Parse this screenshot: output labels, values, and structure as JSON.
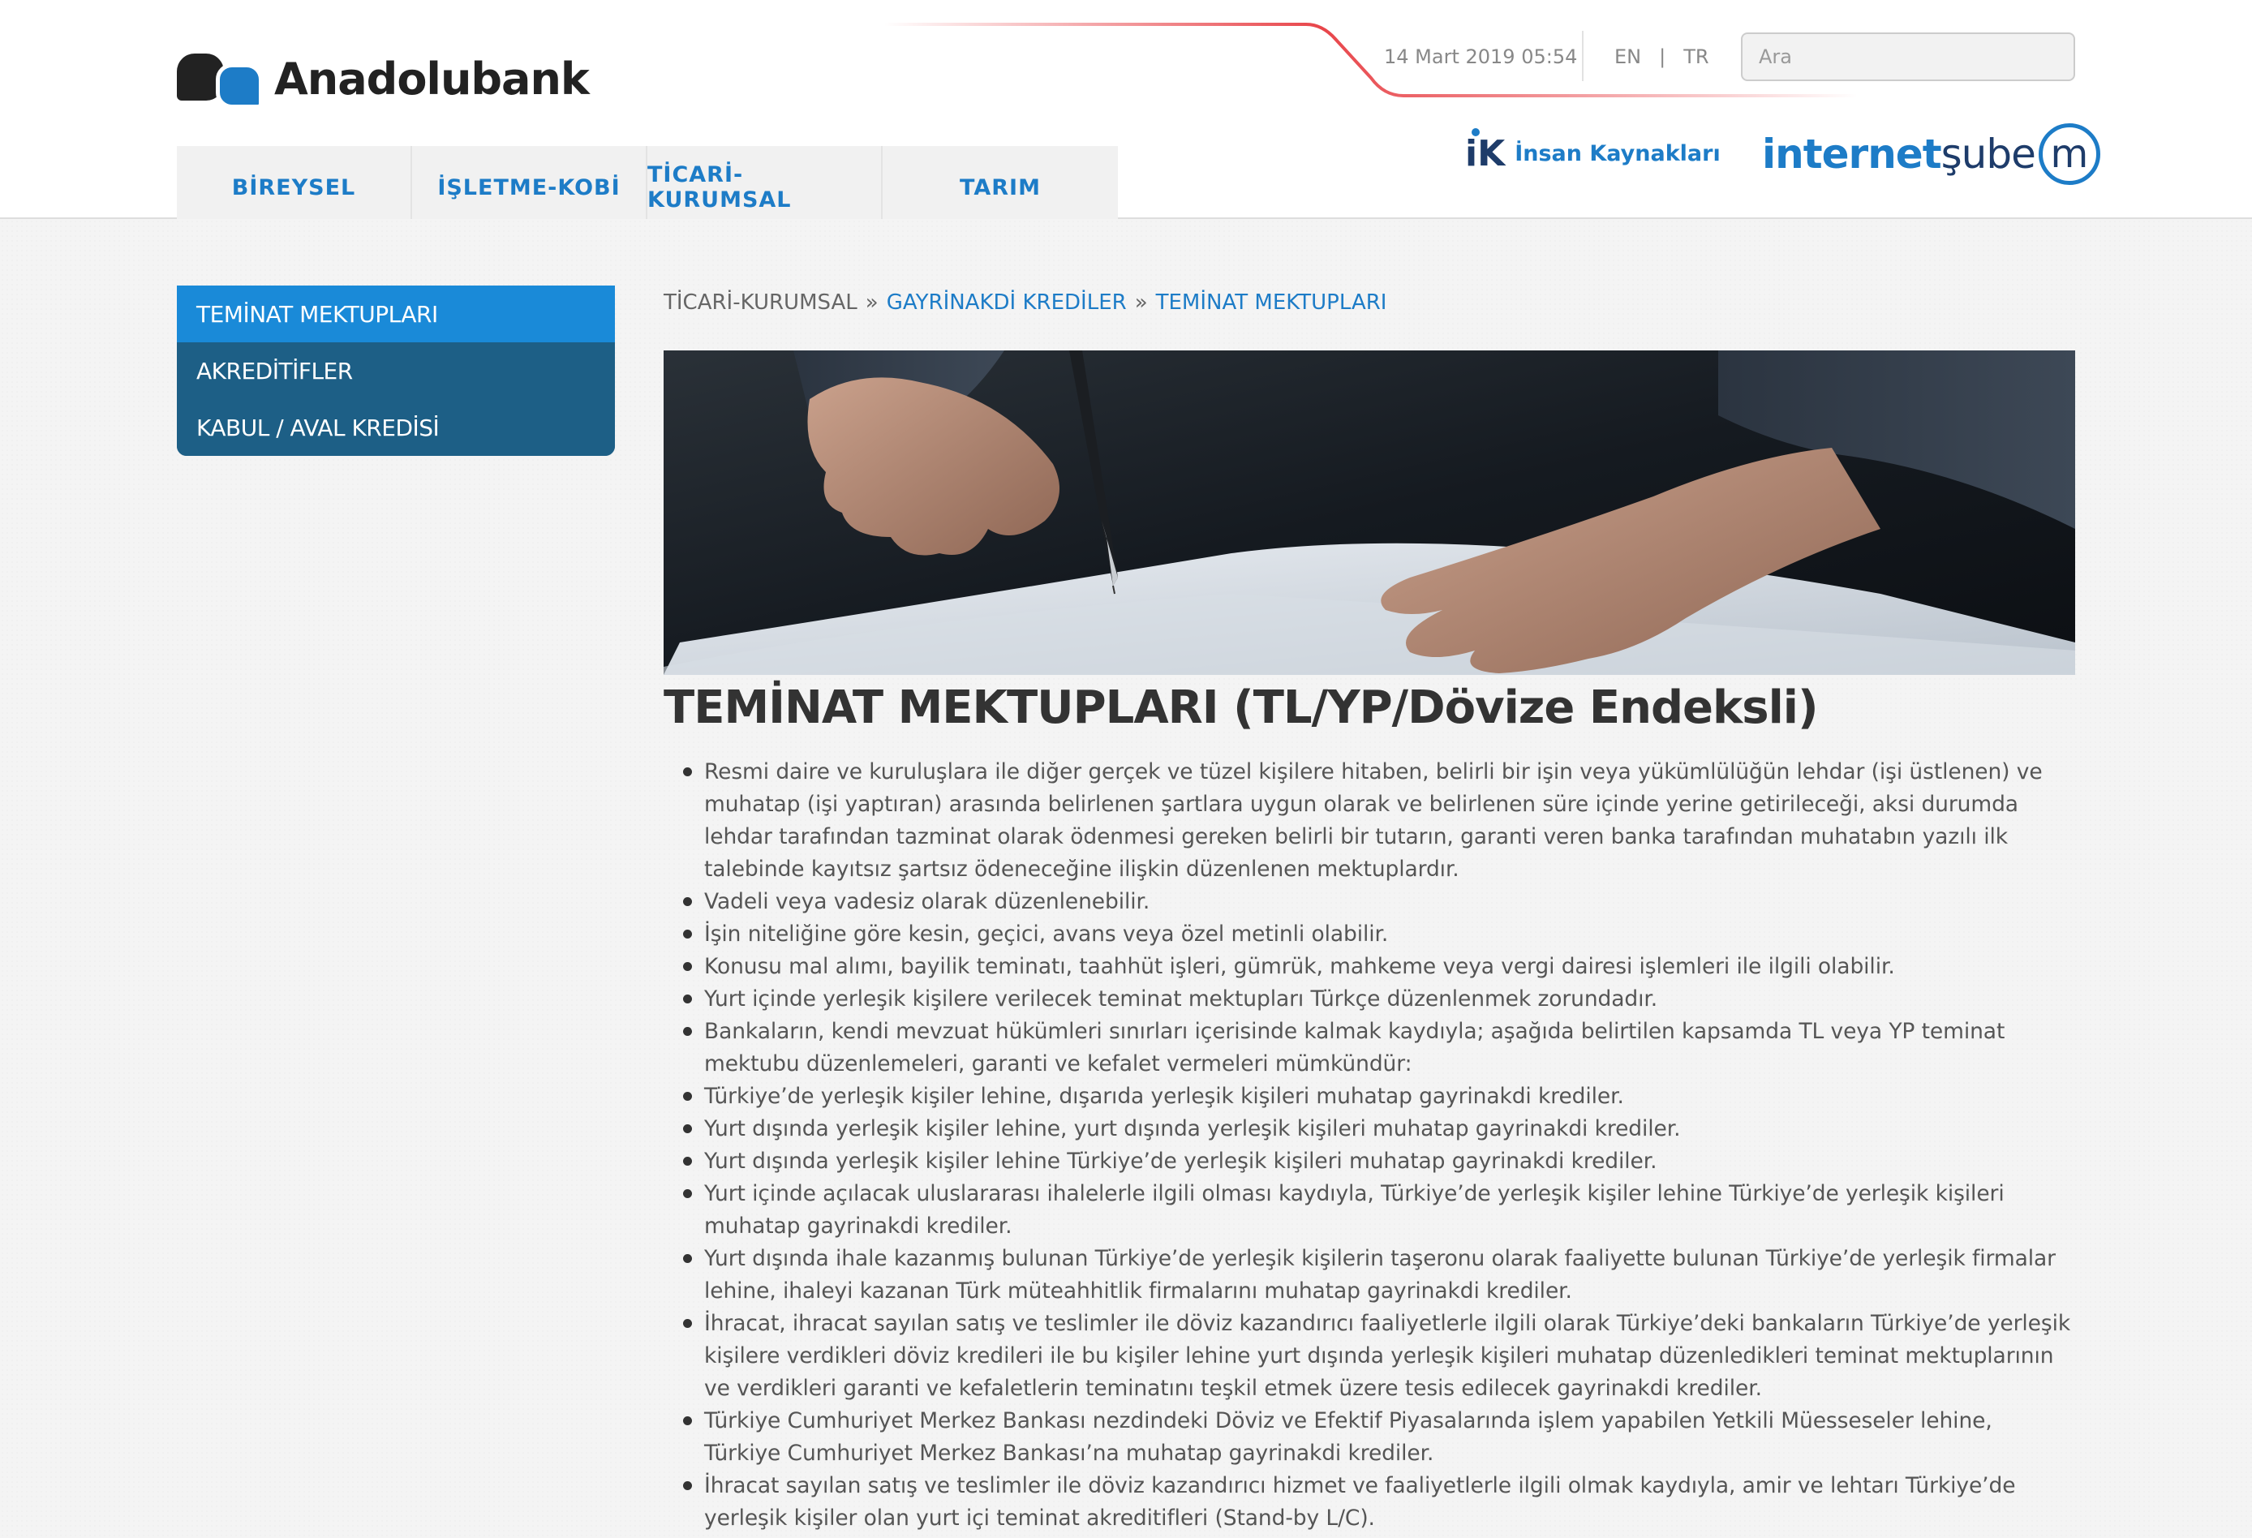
{
  "header": {
    "logo_text": "Anadolubank",
    "date": "14 Mart 2019 05:54",
    "languages": [
      "EN",
      "|",
      "TR"
    ],
    "search_placeholder": "Ara",
    "ik_mark": "iK",
    "ik_label": "İnsan Kaynakları",
    "internet_sube": {
      "part1": "internet",
      "part2": "şube",
      "mark": "m"
    }
  },
  "nav": [
    "BİREYSEL",
    "İŞLETME-KOBİ",
    "TİCARİ-KURUMSAL",
    "TARIM"
  ],
  "sidebar": [
    {
      "label": "TEMİNAT MEKTUPLARI",
      "active": true
    },
    {
      "label": "AKREDİTİFLER",
      "active": false
    },
    {
      "label": "KABUL / AVAL KREDİSİ",
      "active": false
    }
  ],
  "breadcrumb": {
    "root": "TİCARİ-KURUMSAL",
    "sep1": "»",
    "mid": "GAYRİNAKDİ KREDİLER",
    "sep2": "»",
    "current": "TEMİNAT MEKTUPLARI"
  },
  "page_title": "TEMİNAT MEKTUPLARI (TL/YP/Dövize Endeksli)",
  "bullets": [
    "Resmi daire ve kuruluşlara ile diğer gerçek ve tüzel kişilere hitaben, belirli bir işin veya yükümlülüğün lehdar (işi üstlenen) ve muhatap (işi yaptıran) arasında belirlenen şartlara uygun olarak ve belirlenen süre içinde yerine getirileceği, aksi durumda lehdar tarafından tazminat olarak ödenmesi gereken belirli bir tutarın, garanti veren banka tarafından muhatabın yazılı ilk talebinde kayıtsız şartsız ödeneceğine ilişkin düzenlenen mektuplardır.",
    "Vadeli veya vadesiz olarak düzenlenebilir.",
    "İşin niteliğine göre kesin, geçici, avans veya özel metinli olabilir.",
    "Konusu mal alımı, bayilik teminatı, taahhüt işleri, gümrük, mahkeme veya vergi dairesi işlemleri ile ilgili olabilir.",
    "Yurt içinde yerleşik kişilere verilecek teminat mektupları Türkçe düzenlenmek zorundadır.",
    "Bankaların, kendi mevzuat hükümleri sınırları içerisinde kalmak kaydıyla; aşağıda belirtilen kapsamda TL veya YP teminat mektubu düzenlemeleri, garanti ve kefalet vermeleri mümkündür:",
    "Türkiye’de yerleşik kişiler lehine, dışarıda yerleşik kişileri muhatap gayrinakdi krediler.",
    "Yurt dışında yerleşik kişiler lehine, yurt dışında yerleşik kişileri muhatap gayrinakdi krediler.",
    "Yurt dışında yerleşik kişiler lehine Türkiye’de yerleşik kişileri muhatap gayrinakdi krediler.",
    "Yurt içinde açılacak uluslararası ihalelerle ilgili olması kaydıyla, Türkiye’de yerleşik kişiler lehine Türkiye’de yerleşik kişileri muhatap gayrinakdi krediler.",
    "Yurt dışında ihale kazanmış bulunan Türkiye’de yerleşik kişilerin taşeronu olarak faaliyette bulunan Türkiye’de yerleşik firmalar lehine, ihaleyi kazanan Türk müteahhitlik firmalarını muhatap gayrinakdi krediler.",
    "İhracat, ihracat sayılan satış ve teslimler ile döviz kazandırıcı faaliyetlerle ilgili olarak Türkiye’deki bankaların Türkiye’de yerleşik kişilere verdikleri döviz kredileri ile bu kişiler lehine yurt dışında yerleşik kişileri muhatap düzenledikleri teminat mektuplarının ve verdikleri garanti ve kefaletlerin teminatını teşkil etmek üzere tesis edilecek gayrinakdi krediler.",
    "Türkiye Cumhuriyet Merkez Bankası nezdindeki Döviz ve Efektif Piyasalarında işlem yapabilen Yetkili Müesseseler lehine, Türkiye Cumhuriyet Merkez Bankası’na muhatap gayrinakdi krediler.",
    "İhracat sayılan satış ve teslimler ile döviz kazandırıcı hizmet ve faaliyetlerle ilgili olmak kaydıyla, amir ve lehtarı Türkiye’de yerleşik kişiler olan yurt içi teminat akreditifleri (Stand-by L/C)."
  ],
  "colors": {
    "brand_blue": "#1d7cc7",
    "sidebar_active": "#1a8ad8",
    "sidebar_bg": "#1d5f86",
    "accent_red": "#e8454a"
  }
}
